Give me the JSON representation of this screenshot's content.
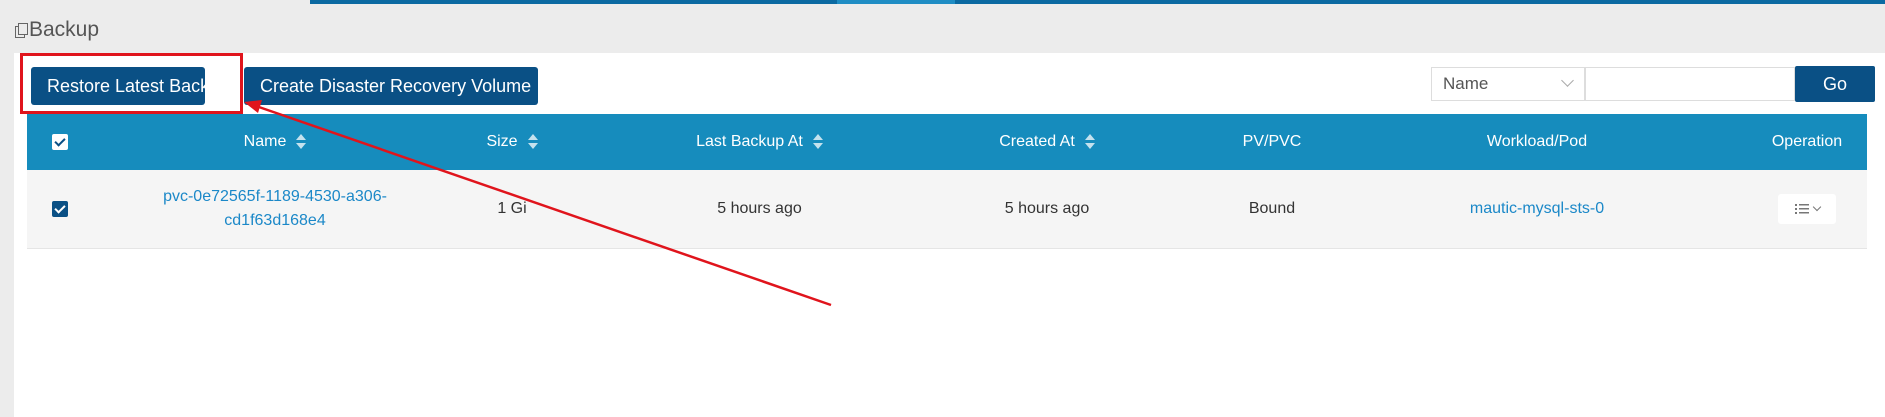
{
  "page": {
    "title": "Backup"
  },
  "toolbar": {
    "restore_label": "Restore Latest Backup",
    "dr_label": "Create Disaster Recovery Volume"
  },
  "search": {
    "field_selected": "Name",
    "query_value": "",
    "go_label": "Go"
  },
  "table": {
    "headers": {
      "name": "Name",
      "size": "Size",
      "last_backup": "Last Backup At",
      "created": "Created At",
      "pv_pvc": "PV/PVC",
      "workload": "Workload/Pod",
      "operation": "Operation"
    },
    "rows": [
      {
        "name_line1": "pvc-0e72565f-1189-4530-a306-",
        "name_line2": "cd1f63d168e4",
        "size": "1 Gi",
        "last_backup": "5 hours ago",
        "created": "5 hours ago",
        "pv_pvc": "Bound",
        "workload": "mautic-mysql-sts-0",
        "checked": true
      }
    ],
    "select_all_checked": true
  },
  "colors": {
    "primary": "#0a5085",
    "header": "#168cbd",
    "link": "#1b88c8",
    "annotation": "#e0141c"
  },
  "icons": {
    "title": "copy-icon",
    "sort": "sort-icon",
    "operation": "list-icon",
    "dropdown": "chevron-down-icon"
  }
}
